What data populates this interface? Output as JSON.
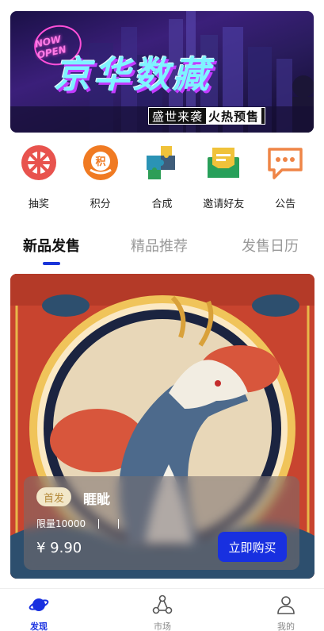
{
  "banner": {
    "title": "京华数藏",
    "subtitle_main": "盛世来袭",
    "subtitle_hot": "火热预售",
    "neon_sign": "NOW OPEN"
  },
  "menu": {
    "items": [
      {
        "label": "抽奖",
        "icon": "lottery-wheel-icon"
      },
      {
        "label": "积分",
        "icon": "points-icon"
      },
      {
        "label": "合成",
        "icon": "puzzle-compose-icon"
      },
      {
        "label": "邀请好友",
        "icon": "invite-envelope-icon"
      },
      {
        "label": "公告",
        "icon": "announcement-chat-icon"
      }
    ],
    "points_glyph": "积"
  },
  "tabs": [
    {
      "label": "新品发售",
      "active": true
    },
    {
      "label": "精品推荐",
      "active": false
    },
    {
      "label": "发售日历",
      "active": false
    }
  ],
  "card": {
    "badge": "首发",
    "name": "睚眦",
    "limit": "限量10000",
    "price": "¥ 9.90",
    "buy_label": "立即购买"
  },
  "bottom_nav": [
    {
      "label": "发现",
      "icon": "planet-icon",
      "active": true
    },
    {
      "label": "市场",
      "icon": "network-nodes-icon",
      "active": false
    },
    {
      "label": "我的",
      "icon": "user-icon",
      "active": false
    }
  ],
  "colors": {
    "accent": "#1830e0",
    "lottery": "#e8534e",
    "points": "#f07a22",
    "invite": "#2e9e57",
    "announce": "#ef8547"
  }
}
